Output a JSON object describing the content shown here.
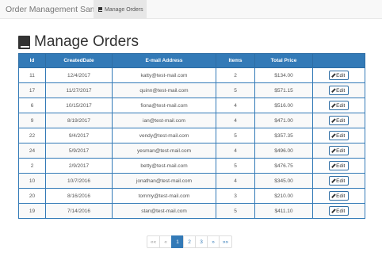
{
  "navbar": {
    "brand": "Order Management Sample",
    "active_item": "Manage Orders"
  },
  "page": {
    "title": "Manage Orders"
  },
  "table": {
    "columns": [
      "Id",
      "CreatedDate",
      "E-mail Address",
      "Items",
      "Total Price",
      ""
    ],
    "rows": [
      {
        "id": "11",
        "date": "12/4/2017",
        "email": "katty@test-mail.com",
        "items": "2",
        "price": "$134.00"
      },
      {
        "id": "17",
        "date": "11/27/2017",
        "email": "quinn@test-mail.com",
        "items": "5",
        "price": "$571.15"
      },
      {
        "id": "6",
        "date": "10/15/2017",
        "email": "fiona@test-mail.com",
        "items": "4",
        "price": "$516.00"
      },
      {
        "id": "9",
        "date": "8/19/2017",
        "email": "ian@test-mail.com",
        "items": "4",
        "price": "$471.00"
      },
      {
        "id": "22",
        "date": "9/4/2017",
        "email": "vendy@test-mail.com",
        "items": "5",
        "price": "$357.35"
      },
      {
        "id": "24",
        "date": "5/9/2017",
        "email": "yesman@test-mail.com",
        "items": "4",
        "price": "$496.00"
      },
      {
        "id": "2",
        "date": "2/9/2017",
        "email": "betty@test-mail.com",
        "items": "5",
        "price": "$476.75"
      },
      {
        "id": "10",
        "date": "10/7/2016",
        "email": "jonathan@test-mail.com",
        "items": "4",
        "price": "$345.00"
      },
      {
        "id": "20",
        "date": "8/16/2016",
        "email": "tommy@test-mail.com",
        "items": "3",
        "price": "$210.00"
      },
      {
        "id": "19",
        "date": "7/14/2016",
        "email": "stan@test-mail.com",
        "items": "5",
        "price": "$411.10"
      }
    ],
    "edit_label": "Edit"
  },
  "pagination": {
    "first": "««",
    "prev": "«",
    "pages": [
      "1",
      "2",
      "3"
    ],
    "current_page": "1",
    "next": "»",
    "last": "»»"
  },
  "colors": {
    "accent": "#337ab7",
    "navbar_bg": "#f8f8f8"
  },
  "icons": {
    "title": "book-icon",
    "nav": "book-icon",
    "edit": "pencil-icon"
  }
}
